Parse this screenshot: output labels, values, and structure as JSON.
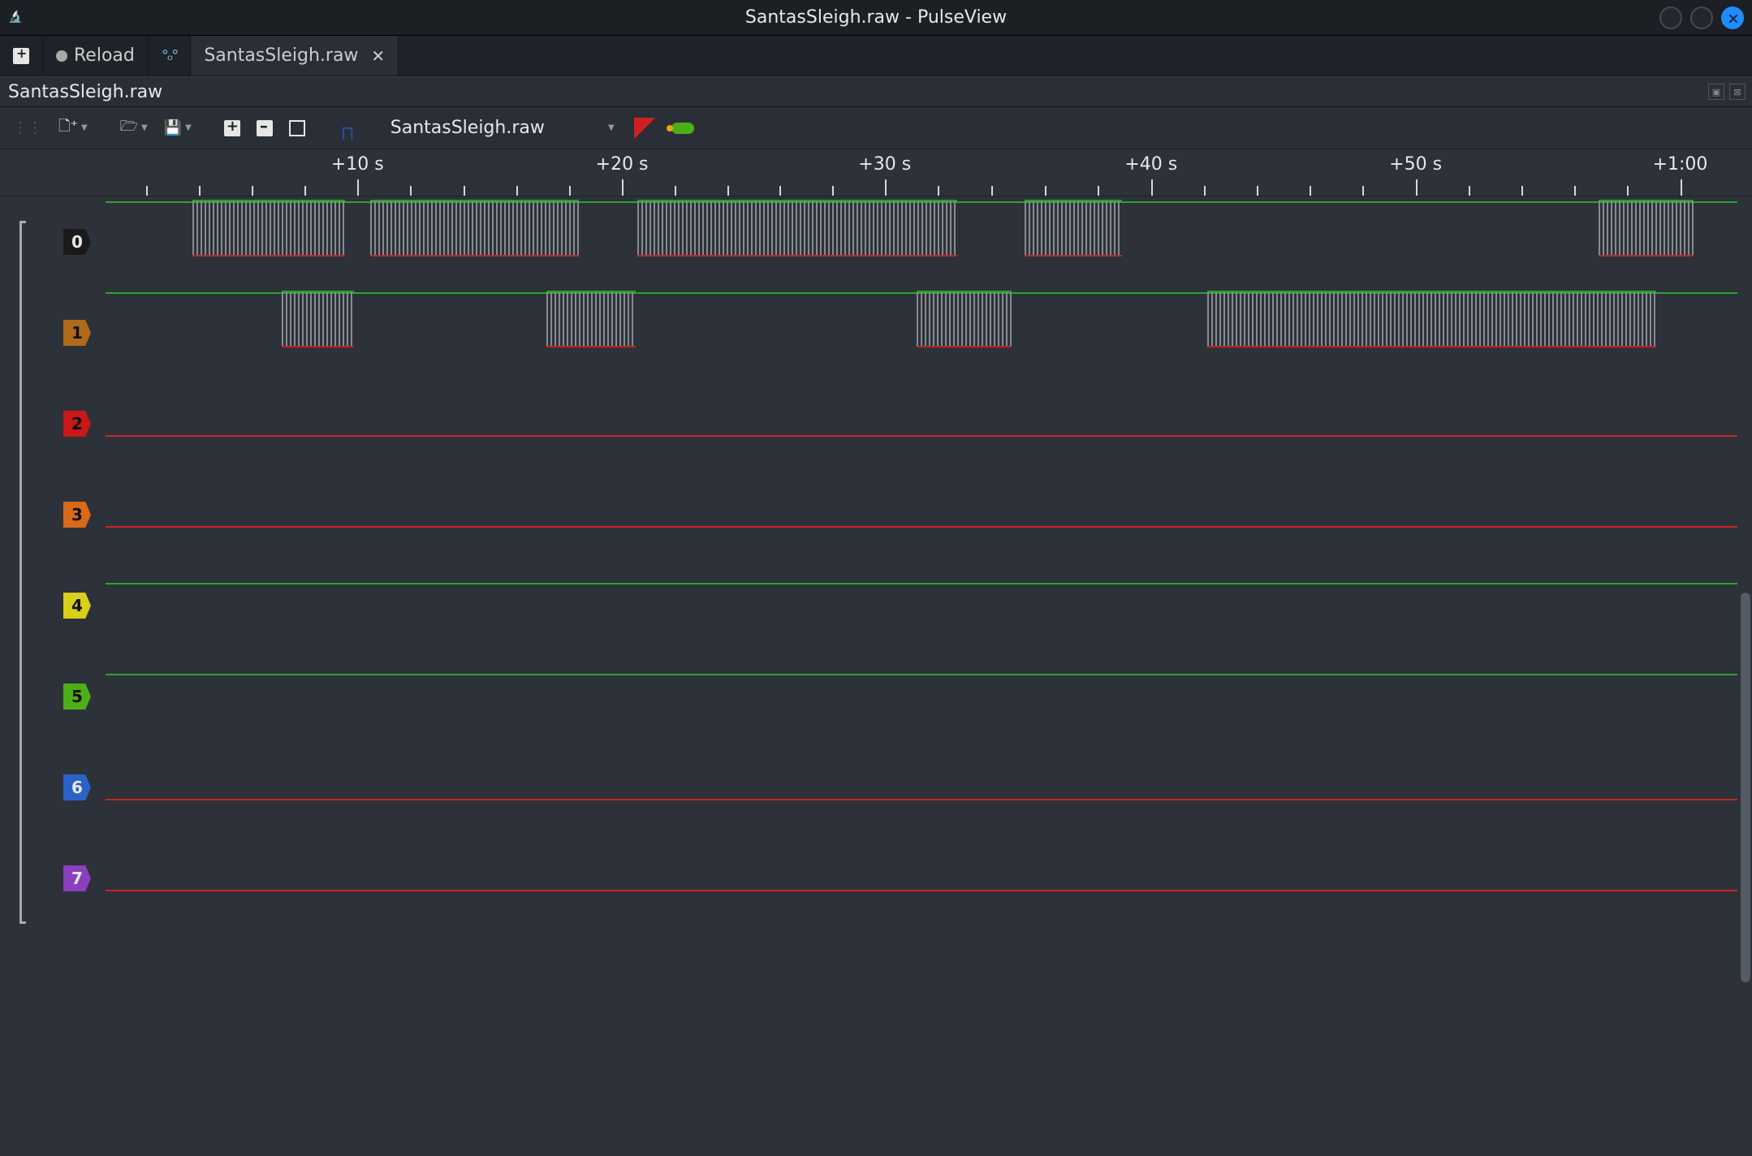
{
  "window": {
    "title": "SantasSleigh.raw - PulseView"
  },
  "tabs": {
    "new_tab_tooltip": "New Session",
    "reload_label": "Reload",
    "protocol_tab_tooltip": "Protocol Decoders",
    "file_tab_label": "SantasSleigh.raw"
  },
  "session": {
    "name": "SantasSleigh.raw"
  },
  "toolbar": {
    "device_selected": "SantasSleigh.raw"
  },
  "timeAxis": {
    "major_labels": [
      "+10 s",
      "+20 s",
      "+30 s",
      "+40 s",
      "+50 s",
      "+1:00"
    ],
    "major_positions_pct": [
      20.4,
      35.5,
      50.5,
      65.7,
      80.8,
      95.9
    ],
    "minor_per_major": 5,
    "origin_pct": 5.3
  },
  "channels": [
    {
      "id": "0",
      "color": "#1a1a1a",
      "text": "#e8e8e8",
      "high": true,
      "bursts_pct": [
        [
          5.3,
          14.7
        ],
        [
          16.2,
          29.0
        ],
        [
          32.6,
          52.2
        ],
        [
          56.3,
          62.3
        ],
        [
          91.5,
          97.3
        ]
      ]
    },
    {
      "id": "1",
      "color": "#b06a1a",
      "text": "#101010",
      "high": true,
      "bursts_pct": [
        [
          10.8,
          15.2
        ],
        [
          27.0,
          32.5
        ],
        [
          49.7,
          55.5
        ],
        [
          67.5,
          95.0
        ]
      ]
    },
    {
      "id": "2",
      "color": "#c81818",
      "text": "#101010",
      "high": false,
      "bursts_pct": []
    },
    {
      "id": "3",
      "color": "#d86a1a",
      "text": "#101010",
      "high": false,
      "bursts_pct": []
    },
    {
      "id": "4",
      "color": "#d8d01a",
      "text": "#101010",
      "high": true,
      "bursts_pct": []
    },
    {
      "id": "5",
      "color": "#4caf18",
      "text": "#101010",
      "high": true,
      "bursts_pct": []
    },
    {
      "id": "6",
      "color": "#2b62c8",
      "text": "#e8e8e8",
      "high": false,
      "bursts_pct": []
    },
    {
      "id": "7",
      "color": "#8a3fbf",
      "text": "#e8e8e8",
      "high": false,
      "bursts_pct": []
    }
  ]
}
